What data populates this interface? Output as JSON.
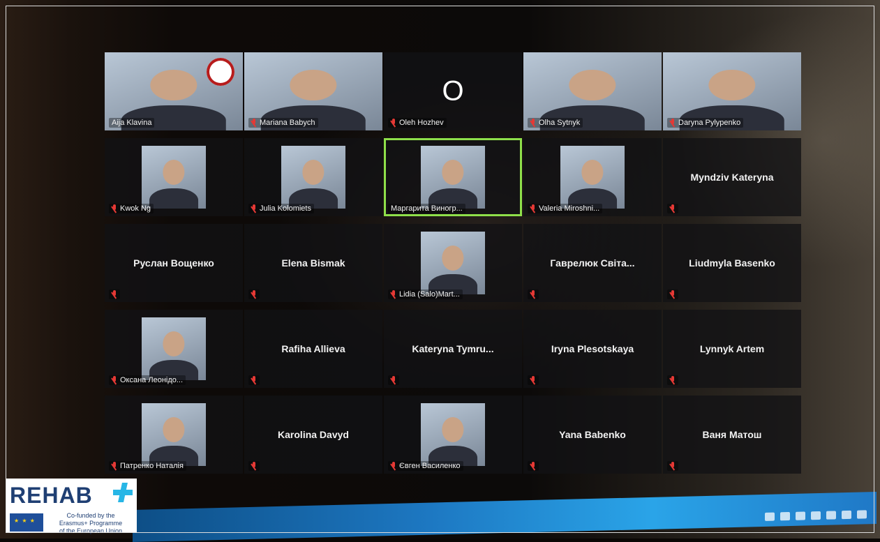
{
  "branding": {
    "logo_word": "REHAB",
    "eu_lines": [
      "Co-funded by the",
      "Erasmus+ Programme",
      "of the European Union"
    ],
    "colors": {
      "navy": "#1f3f73",
      "cyan": "#27b6e6",
      "eu_blue": "#1f4f9a"
    }
  },
  "meeting": {
    "active_color": "#8fe04a",
    "mic_muted_color": "#e53935",
    "tiles": [
      {
        "name": "Aija Klavina",
        "mode": "video",
        "muted": false
      },
      {
        "name": "Mariana Babych",
        "mode": "video",
        "muted": true
      },
      {
        "name": "Olеh Hozhev",
        "mode": "initial",
        "initial": "O",
        "muted": true
      },
      {
        "name": "Olha Sytnyk",
        "mode": "video",
        "muted": true
      },
      {
        "name": "Daryna Pylypenko",
        "mode": "video",
        "muted": true
      },
      {
        "name": "Kwok Ng",
        "mode": "video",
        "muted": true
      },
      {
        "name": "Julia Kolomiets",
        "mode": "video",
        "muted": true
      },
      {
        "name": "Маргарита Виногр...",
        "mode": "video",
        "muted": false,
        "active": true
      },
      {
        "name": "Valeria Miroshni...",
        "mode": "video",
        "muted": true
      },
      {
        "name": "Myndziv Kateryna",
        "mode": "name",
        "muted": true
      },
      {
        "name": "Руслан Вощенко",
        "mode": "name",
        "muted": true
      },
      {
        "name": "Elena Bismak",
        "mode": "name",
        "muted": true
      },
      {
        "name": "Lidia (Salo)Mart...",
        "mode": "video",
        "muted": true
      },
      {
        "name": "Гаврелюк Світа...",
        "mode": "name",
        "muted": true
      },
      {
        "name": "Liudmyla Basenko",
        "mode": "name",
        "muted": true
      },
      {
        "name": "Оксана Леонідо...",
        "mode": "video",
        "muted": true
      },
      {
        "name": "Rafiha Allieva",
        "mode": "name",
        "muted": true
      },
      {
        "name": "Kateryna Tymru...",
        "mode": "name",
        "muted": true
      },
      {
        "name": "Iryna Plesotskaya",
        "mode": "name",
        "muted": true
      },
      {
        "name": "Lynnyk Artem",
        "mode": "name",
        "muted": true
      },
      {
        "name": "Патренко Наталія",
        "mode": "video",
        "muted": true
      },
      {
        "name": "Karolina Davyd",
        "mode": "name",
        "muted": true
      },
      {
        "name": "Євген Василенко",
        "mode": "video",
        "muted": true
      },
      {
        "name": "Yana Babenko",
        "mode": "name",
        "muted": true
      },
      {
        "name": "Ваня Матош",
        "mode": "name",
        "muted": true
      }
    ]
  },
  "taskbar": {
    "tray_icons": [
      "chevron-up-icon",
      "battery-icon",
      "monitor-icon",
      "network-icon",
      "volume-icon",
      "keyboard-icon",
      "notification-icon"
    ]
  }
}
